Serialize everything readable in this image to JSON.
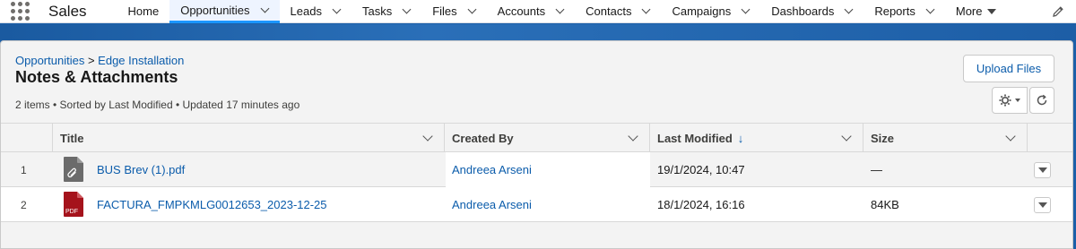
{
  "nav": {
    "app_name": "Sales",
    "items": [
      {
        "label": "Home",
        "has_chevron": false
      },
      {
        "label": "Opportunities",
        "has_chevron": true,
        "active": true
      },
      {
        "label": "Leads",
        "has_chevron": true
      },
      {
        "label": "Tasks",
        "has_chevron": true
      },
      {
        "label": "Files",
        "has_chevron": true
      },
      {
        "label": "Accounts",
        "has_chevron": true
      },
      {
        "label": "Contacts",
        "has_chevron": true
      },
      {
        "label": "Campaigns",
        "has_chevron": true
      },
      {
        "label": "Dashboards",
        "has_chevron": true
      },
      {
        "label": "Reports",
        "has_chevron": true
      },
      {
        "label": "More",
        "has_chevron": false
      }
    ]
  },
  "header": {
    "breadcrumb_parent": "Opportunities",
    "breadcrumb_sep": ">",
    "breadcrumb_record": "Edge Installation",
    "title": "Notes & Attachments",
    "meta": "2 items • Sorted by Last Modified • Updated 17 minutes ago",
    "upload_label": "Upload Files"
  },
  "table": {
    "columns": {
      "title": "Title",
      "created_by": "Created By",
      "last_modified": "Last Modified",
      "size": "Size"
    },
    "rows": [
      {
        "num": "1",
        "title": "BUS Brev (1).pdf",
        "created_by": "Andreea Arseni",
        "last_modified": "19/1/2024, 10:47",
        "size": "—",
        "icon": "attachment-file-icon"
      },
      {
        "num": "2",
        "title": "FACTURA_FMPKMLG0012653_2023-12-25",
        "created_by": "Andreea Arseni",
        "last_modified": "18/1/2024, 16:16",
        "size": "84KB",
        "icon": "pdf-file-icon"
      }
    ]
  },
  "colors": {
    "link": "#0b5cab",
    "brand_band": "#1b5fa8",
    "pdf_red": "#a5131c",
    "generic_file_gray": "#6b6b6b"
  }
}
